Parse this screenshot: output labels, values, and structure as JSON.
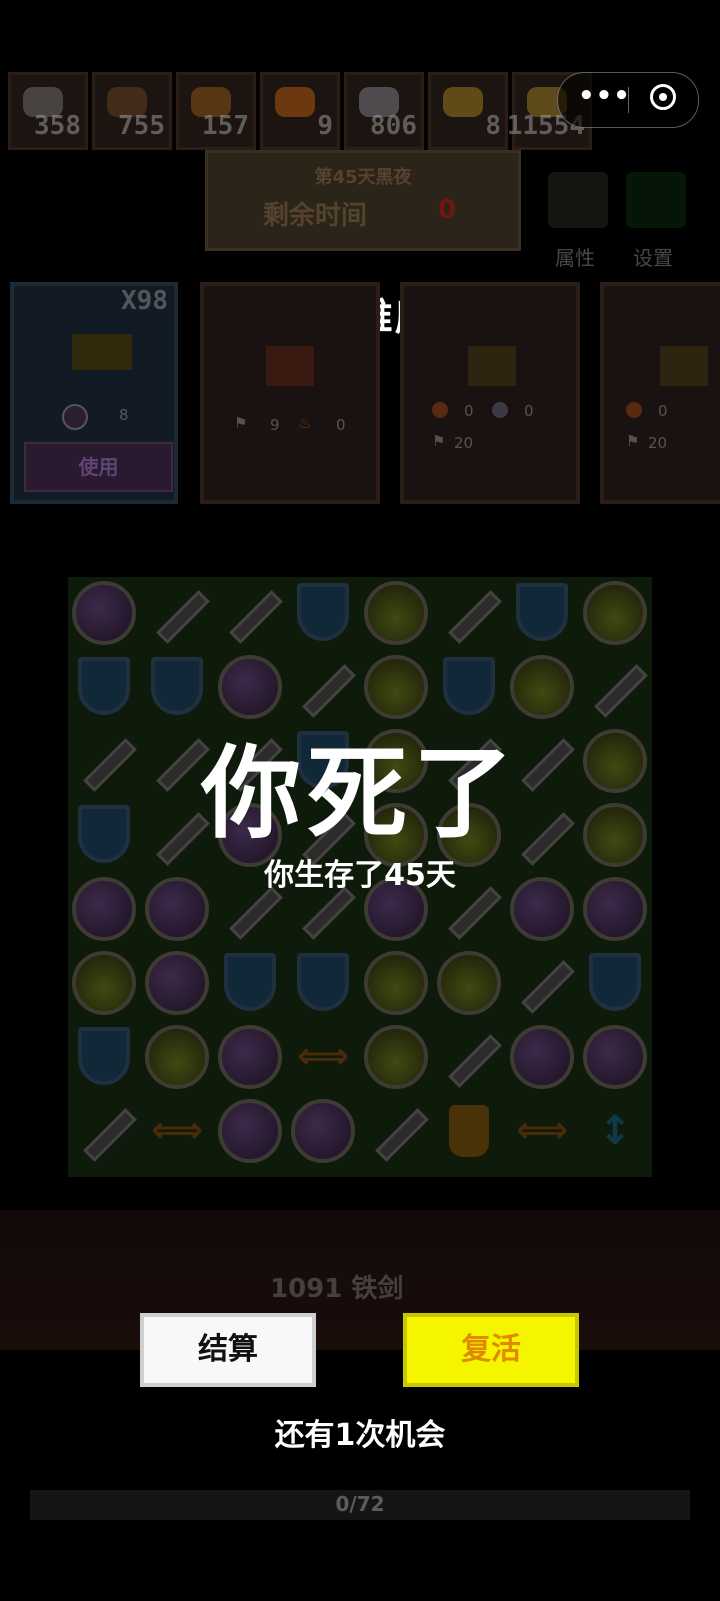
{
  "resources": [
    {
      "icon": "stone-icon",
      "value": "358",
      "color": "#9a9a9a"
    },
    {
      "icon": "wood-icon",
      "value": "755",
      "color": "#8a5a2a"
    },
    {
      "icon": "bread-icon",
      "value": "157",
      "color": "#c8761a"
    },
    {
      "icon": "fire-icon",
      "value": "9",
      "color": "#ff7a10"
    },
    {
      "icon": "iron-icon",
      "value": "806",
      "color": "#b0b0c0"
    },
    {
      "icon": "gold-icon",
      "value": "8",
      "color": "#e0b020"
    },
    {
      "icon": "coin-icon",
      "value": "11554",
      "color": "#d8b030"
    }
  ],
  "banner": {
    "day": "第45天黑夜",
    "remaining_label": "剩余时间",
    "remaining_value": "0"
  },
  "side_buttons": {
    "attributes": "属性",
    "settings": "设置"
  },
  "hero_difficulty": "勇者-难度3",
  "cards": {
    "item": {
      "count": "X98",
      "cost": "8",
      "use_label": "使用"
    },
    "shop1": {
      "power": "9",
      "fire": "0"
    },
    "shop2": {
      "meat": "0",
      "stone": "0",
      "power": "20"
    },
    "shop3": {
      "meat": "0",
      "power": "20"
    }
  },
  "board": {
    "rows": [
      [
        "orb",
        "sword",
        "sword",
        "shield",
        "slime",
        "sword",
        "shield",
        "slime"
      ],
      [
        "shield",
        "shield",
        "orb",
        "sword",
        "slime",
        "shield",
        "slime",
        "sword"
      ],
      [
        "sword",
        "sword",
        "sword",
        "shield",
        "slime",
        "sword",
        "sword",
        "slime"
      ],
      [
        "shield",
        "sword",
        "orb",
        "sword",
        "slime",
        "slime",
        "sword",
        "slime"
      ],
      [
        "orb",
        "orb",
        "sword",
        "sword",
        "orb",
        "sword",
        "orb",
        "orb"
      ],
      [
        "slime",
        "orb",
        "shield",
        "shield",
        "slime",
        "slime",
        "sword",
        "shield"
      ],
      [
        "shield",
        "slime",
        "orb",
        "arrowh",
        "slime",
        "sword",
        "orb",
        "orb"
      ],
      [
        "sword",
        "arrowh",
        "orb",
        "orb",
        "sword",
        "potion",
        "arrowh",
        "arrowv"
      ]
    ]
  },
  "death": {
    "title": "你死了",
    "survived": "你生存了45天"
  },
  "buttons": {
    "settle": "结算",
    "revive": "复活"
  },
  "chances": "还有1次机会",
  "scene": {
    "enemy_label": "1091 铁剑"
  },
  "progress": {
    "current": 0,
    "max": 72,
    "label": "0/72"
  }
}
